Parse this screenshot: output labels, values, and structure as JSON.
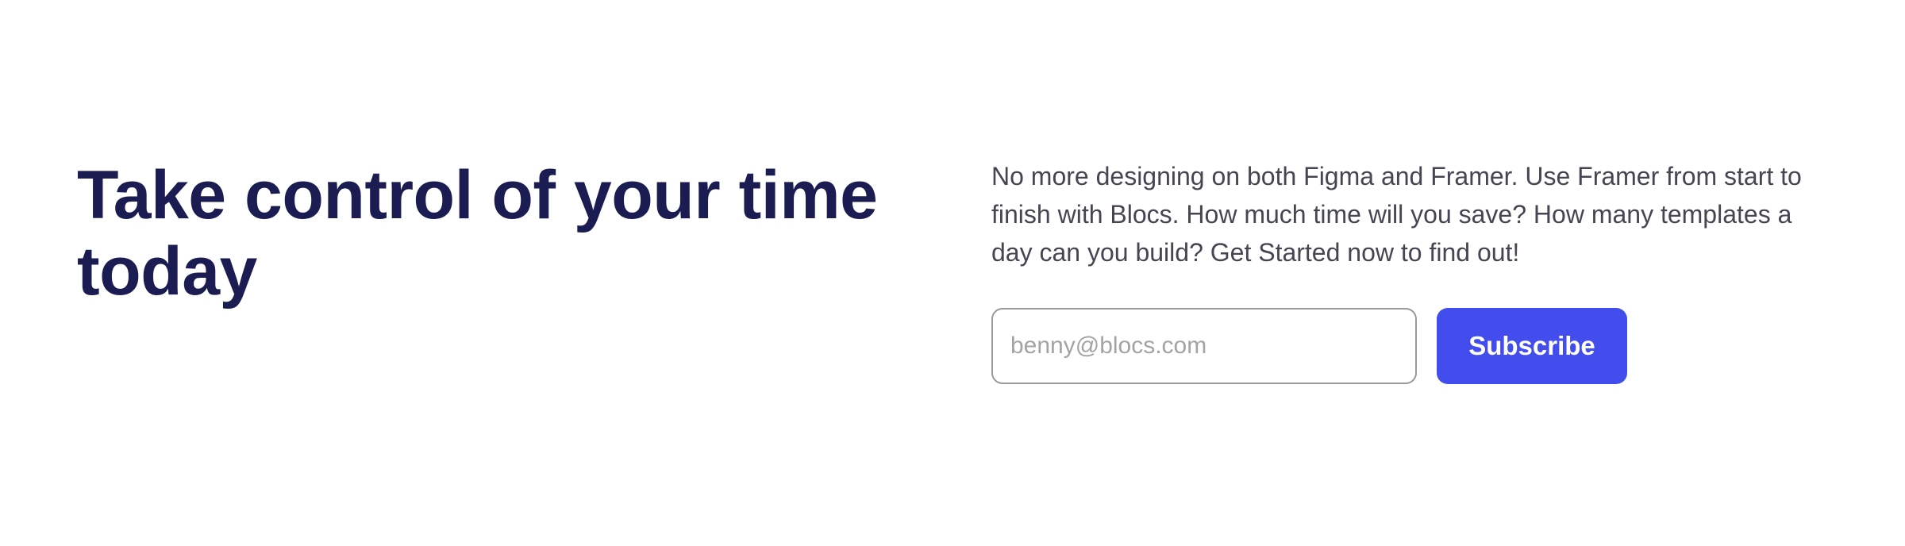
{
  "cta": {
    "heading": "Take control of your time today",
    "description": "No more designing on both Figma and Framer. Use Framer from start to finish with Blocs. How much time will you save? How many templates a day can you build? Get Started now to find out!",
    "email": {
      "value": "",
      "placeholder": "benny@blocs.com"
    },
    "subscribe_label": "Subscribe"
  },
  "colors": {
    "heading": "#1a1c52",
    "body_text": "#454652",
    "button_bg": "#434ced",
    "button_text": "#ffffff",
    "input_border": "#9a9a9a",
    "placeholder": "#a3a3a3",
    "background": "#ffffff"
  }
}
